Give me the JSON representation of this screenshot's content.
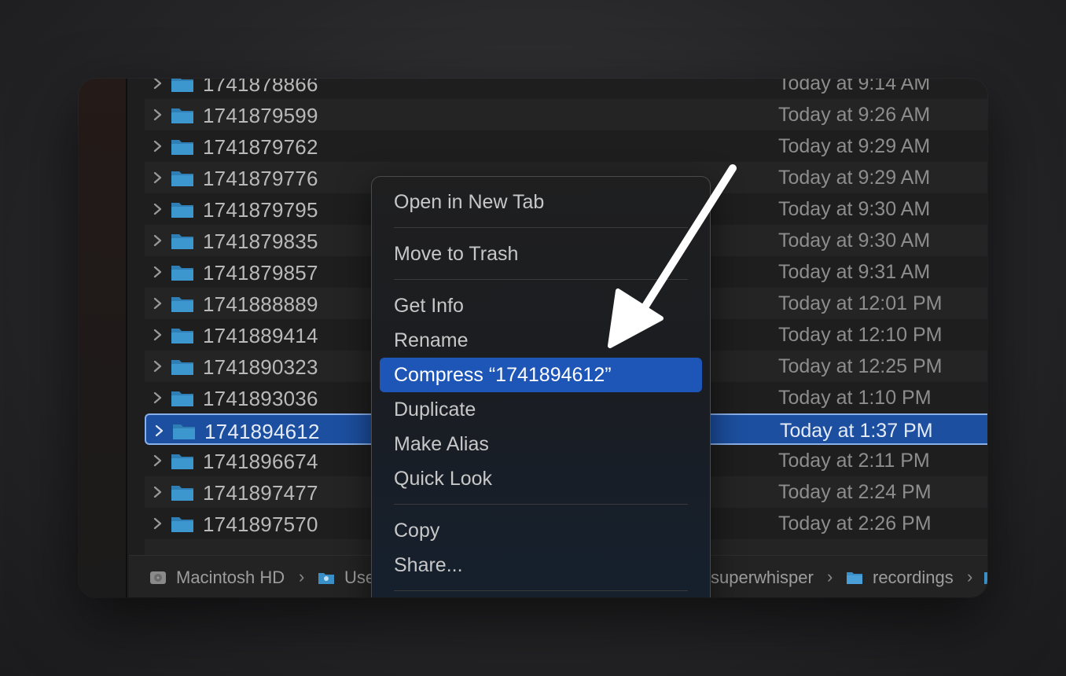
{
  "rows": [
    {
      "name": "1741878866",
      "date": "Today at 9:14 AM"
    },
    {
      "name": "1741879599",
      "date": "Today at 9:26 AM"
    },
    {
      "name": "1741879762",
      "date": "Today at 9:29 AM"
    },
    {
      "name": "1741879776",
      "date": "Today at 9:29 AM"
    },
    {
      "name": "1741879795",
      "date": "Today at 9:30 AM"
    },
    {
      "name": "1741879835",
      "date": "Today at 9:30 AM"
    },
    {
      "name": "1741879857",
      "date": "Today at 9:31 AM"
    },
    {
      "name": "1741888889",
      "date": "Today at 12:01 PM"
    },
    {
      "name": "1741889414",
      "date": "Today at 12:10 PM"
    },
    {
      "name": "1741890323",
      "date": "Today at 12:25 PM"
    },
    {
      "name": "1741893036",
      "date": "Today at 1:10 PM"
    },
    {
      "name": "1741894612",
      "date": "Today at 1:37 PM"
    },
    {
      "name": "1741896674",
      "date": "Today at 2:11 PM"
    },
    {
      "name": "1741897477",
      "date": "Today at 2:24 PM"
    },
    {
      "name": "1741897570",
      "date": "Today at 2:26 PM"
    }
  ],
  "selected_index": 11,
  "context_menu": {
    "open_new_tab": "Open in New Tab",
    "move_to_trash": "Move to Trash",
    "get_info": "Get Info",
    "rename": "Rename",
    "compress": "Compress “1741894612”",
    "duplicate": "Duplicate",
    "make_alias": "Make Alias",
    "quick_look": "Quick Look",
    "copy": "Copy",
    "share": "Share..."
  },
  "pathbar": {
    "disk": "Macintosh HD",
    "users": "Use",
    "superwhisper": "superwhisper",
    "recordings": "recordings"
  },
  "colors": {
    "selection": "#1c4f9f",
    "menu_highlight": "#1e56b8",
    "folder_blue": "#3a8fc7"
  }
}
